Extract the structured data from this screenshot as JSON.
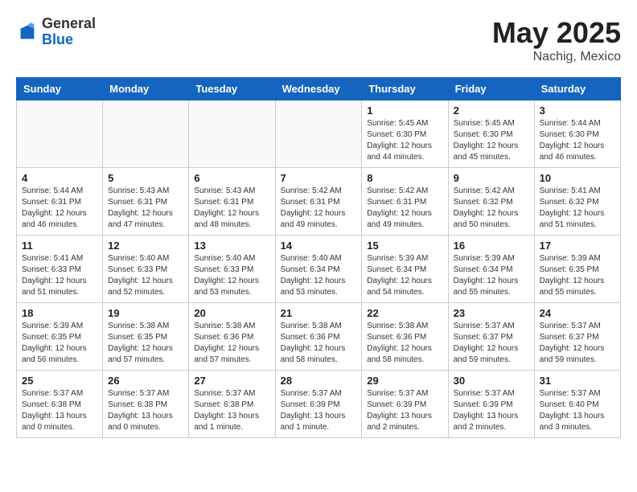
{
  "header": {
    "logo_general": "General",
    "logo_blue": "Blue",
    "title": "May 2025",
    "location": "Nachig, Mexico"
  },
  "days_of_week": [
    "Sunday",
    "Monday",
    "Tuesday",
    "Wednesday",
    "Thursday",
    "Friday",
    "Saturday"
  ],
  "weeks": [
    [
      {
        "day": "",
        "info": ""
      },
      {
        "day": "",
        "info": ""
      },
      {
        "day": "",
        "info": ""
      },
      {
        "day": "",
        "info": ""
      },
      {
        "day": "1",
        "info": "Sunrise: 5:45 AM\nSunset: 6:30 PM\nDaylight: 12 hours\nand 44 minutes."
      },
      {
        "day": "2",
        "info": "Sunrise: 5:45 AM\nSunset: 6:30 PM\nDaylight: 12 hours\nand 45 minutes."
      },
      {
        "day": "3",
        "info": "Sunrise: 5:44 AM\nSunset: 6:30 PM\nDaylight: 12 hours\nand 46 minutes."
      }
    ],
    [
      {
        "day": "4",
        "info": "Sunrise: 5:44 AM\nSunset: 6:31 PM\nDaylight: 12 hours\nand 46 minutes."
      },
      {
        "day": "5",
        "info": "Sunrise: 5:43 AM\nSunset: 6:31 PM\nDaylight: 12 hours\nand 47 minutes."
      },
      {
        "day": "6",
        "info": "Sunrise: 5:43 AM\nSunset: 6:31 PM\nDaylight: 12 hours\nand 48 minutes."
      },
      {
        "day": "7",
        "info": "Sunrise: 5:42 AM\nSunset: 6:31 PM\nDaylight: 12 hours\nand 49 minutes."
      },
      {
        "day": "8",
        "info": "Sunrise: 5:42 AM\nSunset: 6:31 PM\nDaylight: 12 hours\nand 49 minutes."
      },
      {
        "day": "9",
        "info": "Sunrise: 5:42 AM\nSunset: 6:32 PM\nDaylight: 12 hours\nand 50 minutes."
      },
      {
        "day": "10",
        "info": "Sunrise: 5:41 AM\nSunset: 6:32 PM\nDaylight: 12 hours\nand 51 minutes."
      }
    ],
    [
      {
        "day": "11",
        "info": "Sunrise: 5:41 AM\nSunset: 6:33 PM\nDaylight: 12 hours\nand 51 minutes."
      },
      {
        "day": "12",
        "info": "Sunrise: 5:40 AM\nSunset: 6:33 PM\nDaylight: 12 hours\nand 52 minutes."
      },
      {
        "day": "13",
        "info": "Sunrise: 5:40 AM\nSunset: 6:33 PM\nDaylight: 12 hours\nand 53 minutes."
      },
      {
        "day": "14",
        "info": "Sunrise: 5:40 AM\nSunset: 6:34 PM\nDaylight: 12 hours\nand 53 minutes."
      },
      {
        "day": "15",
        "info": "Sunrise: 5:39 AM\nSunset: 6:34 PM\nDaylight: 12 hours\nand 54 minutes."
      },
      {
        "day": "16",
        "info": "Sunrise: 5:39 AM\nSunset: 6:34 PM\nDaylight: 12 hours\nand 55 minutes."
      },
      {
        "day": "17",
        "info": "Sunrise: 5:39 AM\nSunset: 6:35 PM\nDaylight: 12 hours\nand 55 minutes."
      }
    ],
    [
      {
        "day": "18",
        "info": "Sunrise: 5:39 AM\nSunset: 6:35 PM\nDaylight: 12 hours\nand 56 minutes."
      },
      {
        "day": "19",
        "info": "Sunrise: 5:38 AM\nSunset: 6:35 PM\nDaylight: 12 hours\nand 57 minutes."
      },
      {
        "day": "20",
        "info": "Sunrise: 5:38 AM\nSunset: 6:36 PM\nDaylight: 12 hours\nand 57 minutes."
      },
      {
        "day": "21",
        "info": "Sunrise: 5:38 AM\nSunset: 6:36 PM\nDaylight: 12 hours\nand 58 minutes."
      },
      {
        "day": "22",
        "info": "Sunrise: 5:38 AM\nSunset: 6:36 PM\nDaylight: 12 hours\nand 58 minutes."
      },
      {
        "day": "23",
        "info": "Sunrise: 5:37 AM\nSunset: 6:37 PM\nDaylight: 12 hours\nand 59 minutes."
      },
      {
        "day": "24",
        "info": "Sunrise: 5:37 AM\nSunset: 6:37 PM\nDaylight: 12 hours\nand 59 minutes."
      }
    ],
    [
      {
        "day": "25",
        "info": "Sunrise: 5:37 AM\nSunset: 6:38 PM\nDaylight: 13 hours\nand 0 minutes."
      },
      {
        "day": "26",
        "info": "Sunrise: 5:37 AM\nSunset: 6:38 PM\nDaylight: 13 hours\nand 0 minutes."
      },
      {
        "day": "27",
        "info": "Sunrise: 5:37 AM\nSunset: 6:38 PM\nDaylight: 13 hours\nand 1 minute."
      },
      {
        "day": "28",
        "info": "Sunrise: 5:37 AM\nSunset: 6:39 PM\nDaylight: 13 hours\nand 1 minute."
      },
      {
        "day": "29",
        "info": "Sunrise: 5:37 AM\nSunset: 6:39 PM\nDaylight: 13 hours\nand 2 minutes."
      },
      {
        "day": "30",
        "info": "Sunrise: 5:37 AM\nSunset: 6:39 PM\nDaylight: 13 hours\nand 2 minutes."
      },
      {
        "day": "31",
        "info": "Sunrise: 5:37 AM\nSunset: 6:40 PM\nDaylight: 13 hours\nand 3 minutes."
      }
    ]
  ]
}
